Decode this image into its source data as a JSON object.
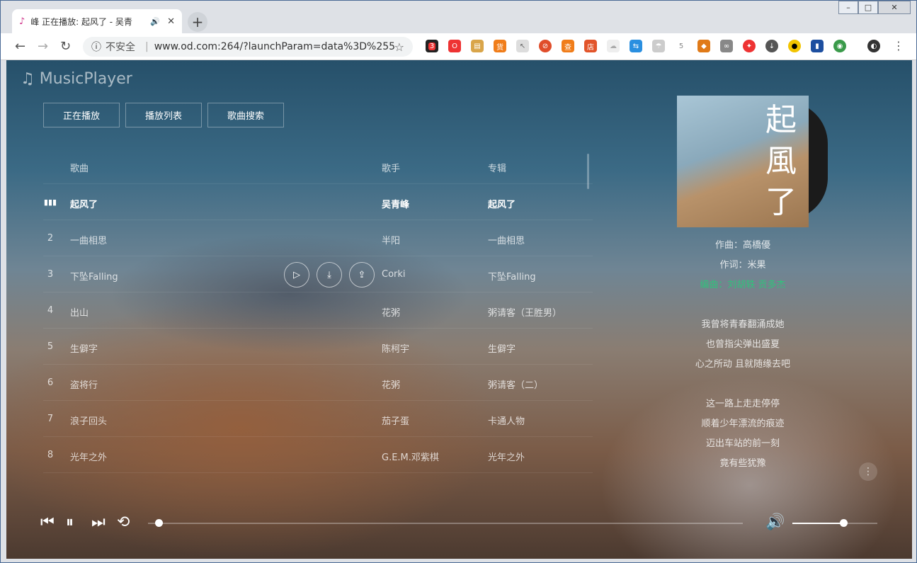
{
  "browser": {
    "tab_title": "峰 正在播放: 起风了 - 吴青",
    "security": "不安全",
    "url": "www.od.com:264/?launchParam=data%3D%255...",
    "ext_badge": "3"
  },
  "app": {
    "logo": "MusicPlayer",
    "nav": [
      "正在播放",
      "播放列表",
      "歌曲搜索"
    ],
    "table": {
      "headers": {
        "song": "歌曲",
        "artist": "歌手",
        "album": "专辑"
      },
      "rows": [
        {
          "num": "",
          "song": "起风了",
          "artist": "吴青峰",
          "album": "起风了"
        },
        {
          "num": "2",
          "song": "一曲相思",
          "artist": "半阳",
          "album": "一曲相思"
        },
        {
          "num": "3",
          "song": "下坠Falling",
          "artist": "Corki",
          "album": "下坠Falling"
        },
        {
          "num": "4",
          "song": "出山",
          "artist": "花粥",
          "album": "粥请客（王胜男）"
        },
        {
          "num": "5",
          "song": "生僻字",
          "artist": "陈柯宇",
          "album": "生僻字"
        },
        {
          "num": "6",
          "song": "盗将行",
          "artist": "花粥",
          "album": "粥请客（二）"
        },
        {
          "num": "7",
          "song": "浪子回头",
          "artist": "茄子蛋",
          "album": "卡通人物"
        },
        {
          "num": "8",
          "song": "光年之外",
          "artist": "G.E.M.邓紫棋",
          "album": "光年之外"
        }
      ]
    },
    "cover_title": "起風了",
    "lyrics": [
      "作曲：高橋優",
      "作词：米果",
      "编曲：刘胡轶 贡多杰",
      "",
      "我曾将青春翻涌成她",
      "也曾指尖弹出盛夏",
      "心之所动 且就随缘去吧",
      "",
      "这一路上走走停停",
      "顺着少年漂流的痕迹",
      "迈出车站的前一刻",
      "竟有些犹豫"
    ],
    "player": {
      "progress": 0.012,
      "volume": 0.6
    },
    "colors": {
      "accent": "#31c27c"
    }
  }
}
